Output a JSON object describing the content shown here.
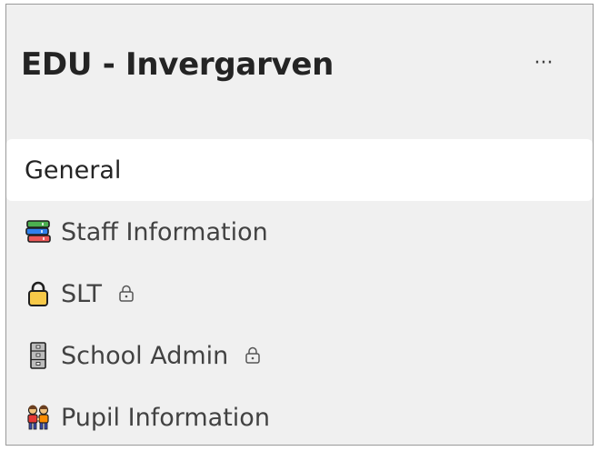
{
  "team": {
    "name": "EDU - Invergarven",
    "more_label": "···"
  },
  "channels": [
    {
      "label": "General",
      "icon": null,
      "private": false,
      "selected": true
    },
    {
      "label": "Staff Information",
      "icon": "books-icon",
      "private": false,
      "selected": false
    },
    {
      "label": "SLT",
      "icon": "locked-padlock-icon",
      "private": true,
      "selected": false
    },
    {
      "label": "School Admin",
      "icon": "filing-cabinet-icon",
      "private": true,
      "selected": false
    },
    {
      "label": "Pupil Information",
      "icon": "children-holding-hands-icon",
      "private": false,
      "selected": false
    }
  ],
  "colors": {
    "panel_bg": "#f0f0f0",
    "selected_bg": "#ffffff",
    "text": "#424242",
    "title": "#242424"
  }
}
